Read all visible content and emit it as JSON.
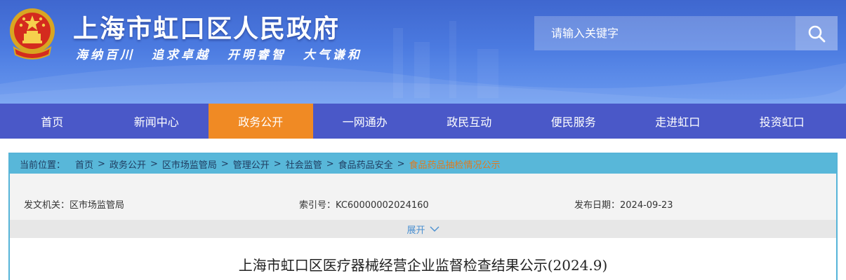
{
  "header": {
    "site_title": "上海市虹口区人民政府",
    "slogan": "海纳百川  追求卓越  开明睿智  大气谦和",
    "search_placeholder": "请输入关键字"
  },
  "nav": {
    "items": [
      {
        "label": "首页"
      },
      {
        "label": "新闻中心"
      },
      {
        "label": "政务公开"
      },
      {
        "label": "一网通办"
      },
      {
        "label": "政民互动"
      },
      {
        "label": "便民服务"
      },
      {
        "label": "走进虹口"
      },
      {
        "label": "投资虹口"
      }
    ],
    "active": "政务公开"
  },
  "breadcrumb": {
    "label": "当前位置：",
    "items": [
      "首页",
      "政务公开",
      "区市场监管局",
      "管理公开",
      "社会监管",
      "食品药品安全",
      "食品药品抽检情况公示"
    ],
    "separator": ">"
  },
  "meta": {
    "issuer_key": "发文机关：",
    "issuer": "区市场监管局",
    "index_key": "索引号：",
    "index": "KC60000002024160",
    "date_key": "发布日期：",
    "date": "2024-09-23"
  },
  "expand_label": "展开",
  "document": {
    "title": "上海市虹口区医疗器械经营企业监督检查结果公示(2024.9)"
  },
  "colors": {
    "header_blue": "#4b7ae0",
    "nav_blue": "#4a58c8",
    "nav_active": "#f08a24",
    "breadcrumb_bar": "#58b7d9",
    "breadcrumb_current": "#e07a1e"
  }
}
